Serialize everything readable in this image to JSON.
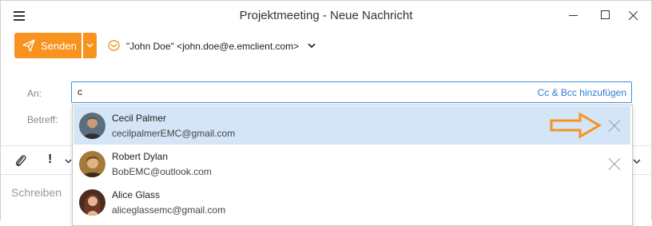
{
  "window": {
    "title": "Projektmeeting - Neue Nachricht",
    "menu_icon": "hamburger-menu-icon",
    "controls": [
      "minimize-icon",
      "maximize-icon",
      "close-icon"
    ]
  },
  "toolbar": {
    "send_label": "Senden",
    "send_icon": "paper-plane-icon",
    "accent_color": "#f7931e"
  },
  "from": {
    "icon": "account-icon",
    "value": "\"John Doe\" <john.doe@e.emclient.com>"
  },
  "fields": {
    "to_label": "An:",
    "to_value": "c",
    "cc_bcc_link": "Cc & Bcc hinzufügen",
    "subject_label": "Betreff:"
  },
  "format_toolbar": {
    "attach_icon": "paperclip-icon",
    "importance_label": "!"
  },
  "body": {
    "placeholder": "Schreiben"
  },
  "autocomplete": {
    "selected_bg": "#d3e5f7",
    "suggestions": [
      {
        "name": "Cecil Palmer",
        "email": "cecilpalmerEMC@gmail.com",
        "selected": true
      },
      {
        "name": "Robert Dylan",
        "email": "BobEMC@outlook.com",
        "selected": false
      },
      {
        "name": "Alice Glass",
        "email": "aliceglassemc@gmail.com",
        "selected": false
      }
    ]
  },
  "annotation": {
    "icon": "orange-arrow-icon",
    "color": "#f7931e"
  }
}
